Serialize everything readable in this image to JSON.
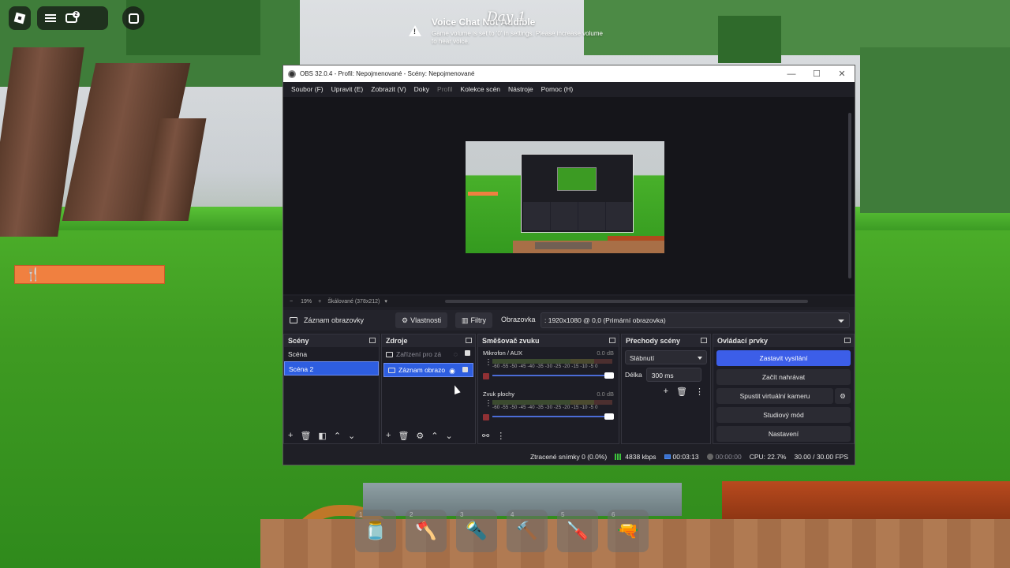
{
  "roblox": {
    "chat_badge": "2",
    "voice_title": "Voice Chat Not Audible",
    "voice_body": "Game volume is set to '0' in settings. Please increase volume to hear voice.",
    "day_label": "Day 1"
  },
  "obs": {
    "title": "OBS 32.0.4 - Profil: Nepojmenované - Scény: Nepojmenované",
    "menu": [
      "Soubor (F)",
      "Upravit (E)",
      "Zobrazit (V)",
      "Doky",
      "Profil",
      "Kolekce scén",
      "Nástroje",
      "Pomoc (H)"
    ],
    "zoom": {
      "minus": "−",
      "value": "19%",
      "plus": "+",
      "scaled": "Škálované (378x212)"
    },
    "source_bar": {
      "source_name": "Záznam obrazovky",
      "properties": "Vlastnosti",
      "filters": "Filtry",
      "screen_label": "Obrazovka",
      "screen_value": ": 1920x1080 @ 0,0 (Primární obrazovka)"
    },
    "docks": {
      "scenes": {
        "title": "Scény",
        "items": [
          "Scéna",
          "Scéna 2"
        ]
      },
      "sources": {
        "title": "Zdroje",
        "items": [
          "Zařízení pro zá",
          "Záznam obrazo"
        ]
      },
      "mixer": {
        "title": "Směšovač zvuku",
        "channels": [
          {
            "name": "Mikrofon / AUX",
            "db": "0.0 dB",
            "scale": "-60 -55 -50 -45 -40 -35 -30 -25 -20 -15 -10 -5 0"
          },
          {
            "name": "Zvuk plochy",
            "db": "0.0 dB",
            "scale": "-60 -55 -50 -45 -40 -35 -30 -25 -20 -15 -10 -5 0"
          }
        ]
      },
      "transitions": {
        "title": "Přechody scény",
        "type": "Slábnutí",
        "duration_label": "Délka",
        "duration": "300 ms"
      },
      "controls": {
        "title": "Ovládací prvky",
        "stop_stream": "Zastavit vysílání",
        "start_record": "Začít nahrávat",
        "virtual_cam": "Spustit virtuální kameru",
        "studio": "Studiový mód",
        "settings": "Nastavení"
      }
    },
    "status": {
      "dropped": "Ztracené snímky 0 (0.0%)",
      "bitrate": "4838 kbps",
      "stream_time": "00:03:13",
      "rec_time": "00:00:00",
      "cpu": "CPU: 22.7%",
      "fps": "30.00 / 30.00 FPS"
    }
  },
  "hotbar": {
    "slots": [
      "1",
      "2",
      "3",
      "4",
      "5",
      "6"
    ]
  },
  "colors": {
    "obs_bg": "#1f1f26",
    "accent": "#3c5ee8",
    "hunger": "#f08040",
    "grass": "#3f9b22"
  }
}
